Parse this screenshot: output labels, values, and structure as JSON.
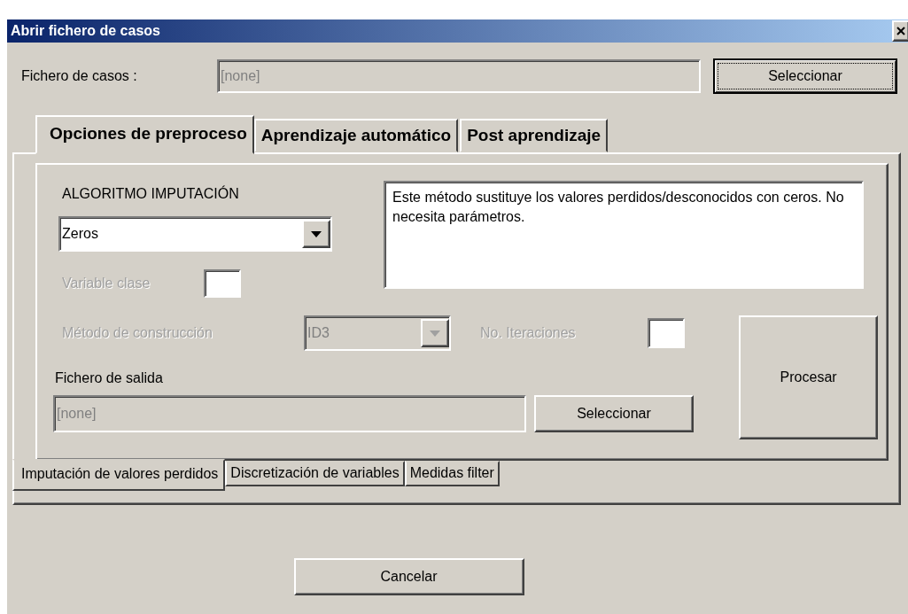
{
  "window": {
    "title": "Abrir fichero de casos"
  },
  "case_file": {
    "label": "Fichero de casos :",
    "value": "[none]",
    "button": "Seleccionar",
    "focused": true
  },
  "main_tabs": [
    {
      "label": "Opciones de preproceso",
      "selected": true
    },
    {
      "label": "Aprendizaje automático",
      "selected": false
    },
    {
      "label": "Post aprendizaje",
      "selected": false
    }
  ],
  "imputation": {
    "heading": "ALGORITMO IMPUTACIÓN",
    "algorithm": "Zeros",
    "description": "Este método sustituye los valores perdidos/desconocidos con ceros. No necesita parámetros.",
    "class_variable": {
      "label": "Variable clase",
      "disabled": true
    },
    "construction_method": {
      "label": "Método de construcción",
      "value": "ID3",
      "disabled": true
    },
    "iterations": {
      "label": "No. Iteraciones",
      "disabled": true
    },
    "output_file": {
      "label": "Fichero de salida",
      "value": "[none]",
      "button": "Seleccionar"
    },
    "process_button": "Procesar"
  },
  "sub_tabs": [
    {
      "label": "Imputación de valores perdidos",
      "selected": true
    },
    {
      "label": "Discretización de variables",
      "selected": false
    },
    {
      "label": "Medidas filter",
      "selected": false
    }
  ],
  "cancel_button": "Cancelar"
}
